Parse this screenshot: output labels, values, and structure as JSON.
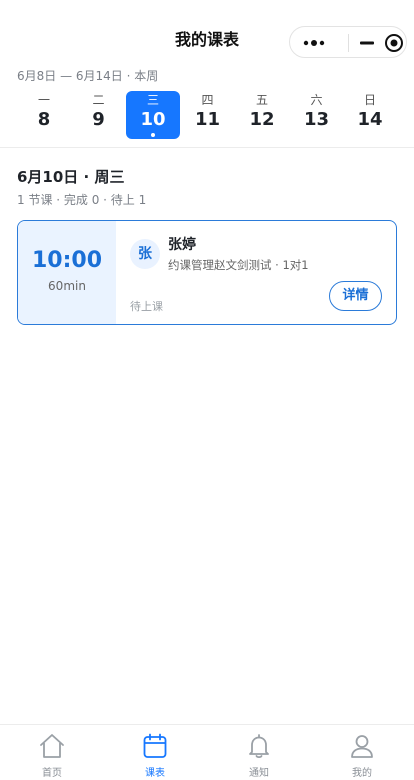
{
  "header": {
    "title": "我的课表",
    "capsule_icons": [
      "more-icon",
      "minimize-icon",
      "target-icon"
    ]
  },
  "week": {
    "range_label": "6月8日 — 6月14日 · 本周",
    "days": [
      {
        "dow": "一",
        "date": "8"
      },
      {
        "dow": "二",
        "date": "9"
      },
      {
        "dow": "三",
        "date": "10",
        "selected": true,
        "has_lesson": true
      },
      {
        "dow": "四",
        "date": "11"
      },
      {
        "dow": "五",
        "date": "12"
      },
      {
        "dow": "六",
        "date": "13"
      },
      {
        "dow": "日",
        "date": "14"
      }
    ]
  },
  "day": {
    "title": "6月10日 · 周三",
    "summary": "1 节课 · 完成 0 · 待上 1"
  },
  "lessons": [
    {
      "time": "10:00",
      "duration": "60min",
      "avatar_text": "张",
      "student": "张婷",
      "description": "约课管理赵文剑测试 · 1对1",
      "status": "待上课",
      "detail_label": "详情"
    }
  ],
  "tabbar": {
    "active": "课表",
    "items": [
      {
        "label": "首页",
        "icon": "home-icon"
      },
      {
        "label": "课表",
        "icon": "calendar-icon"
      },
      {
        "label": "通知",
        "icon": "bell-icon"
      },
      {
        "label": "我的",
        "icon": "user-icon"
      }
    ]
  },
  "colors": {
    "accent": "#1677ff",
    "card_border": "#2b7bd9",
    "time_bg": "#eaf3ff"
  }
}
